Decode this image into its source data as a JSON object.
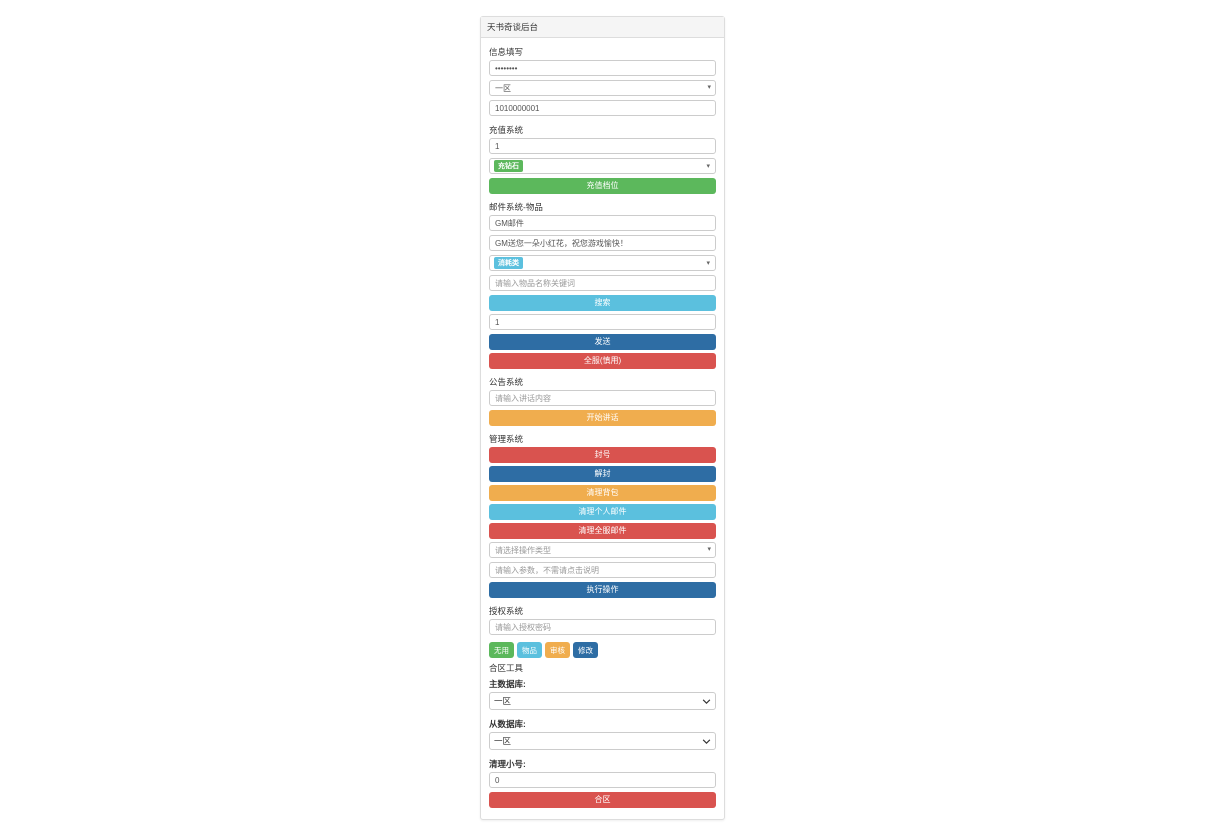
{
  "panel_title": "天书奇谈后台",
  "info": {
    "label": "信息填写",
    "password_value": "********",
    "zone_selected": "一区",
    "uid_value": "1010000001"
  },
  "recharge": {
    "label": "充值系统",
    "amount_value": "1",
    "type_pill": "充钻石",
    "button": "充值档位"
  },
  "mail": {
    "label": "邮件系统-物品",
    "title_value": "GM邮件",
    "content_value": "GM送您一朵小红花，祝您游戏愉快！",
    "category_pill": "消耗类",
    "search_placeholder": "请输入物品名称关键词",
    "search_button": "搜索",
    "quantity_value": "1",
    "send_button": "发送",
    "withdraw_button": "全服(慎用)"
  },
  "bulletin": {
    "label": "公告系统",
    "input_placeholder": "请输入讲话内容",
    "button": "开始讲话"
  },
  "manage": {
    "label": "管理系统",
    "ban_button": "封号",
    "unban_button": "解封",
    "clear_bag_button": "清理背包",
    "clear_personal_mail_button": "清理个人邮件",
    "clear_all_mail_button": "清理全服邮件",
    "op_select_placeholder": "请选择操作类型",
    "op_param_placeholder": "请输入参数，不需请点击说明",
    "execute_button": "执行操作"
  },
  "auth": {
    "label": "授权系统",
    "password_placeholder": "请输入授权密码",
    "none_button": "无用",
    "item_button": "物品",
    "check_button": "审核",
    "modify_button": "修改"
  },
  "merge": {
    "label": "合区工具",
    "main_db_label": "主数据库:",
    "main_db_selected": "一区",
    "slave_db_label": "从数据库:",
    "slave_db_selected": "一区",
    "clear_alt_label": "清理小号:",
    "clear_alt_value": "0",
    "merge_button": "合区"
  }
}
